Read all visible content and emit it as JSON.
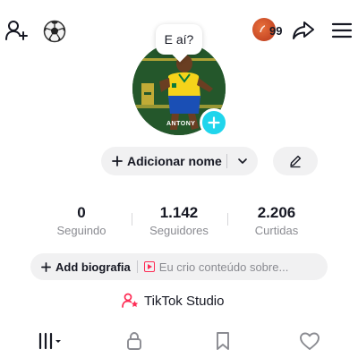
{
  "header": {
    "avatar_bubble": "E aí?",
    "inbox_count": "99"
  },
  "profile": {
    "avatar_caption": "ANTONY",
    "name_button": "Adicionar nome"
  },
  "stats": [
    {
      "value": "0",
      "label": "Seguindo"
    },
    {
      "value": "1.142",
      "label": "Seguidores"
    },
    {
      "value": "2.206",
      "label": "Curtidas"
    }
  ],
  "bio": {
    "add_label": "Add biografia",
    "hint": "Eu crio conteúdo sobre..."
  },
  "studio": {
    "label": "TikTok Studio"
  },
  "tabs": [
    {
      "icon": "grid-icon"
    },
    {
      "icon": "lock-icon"
    },
    {
      "icon": "bookmark-icon"
    },
    {
      "icon": "heart-icon"
    }
  ],
  "colors": {
    "accent_cyan": "#20d5ec",
    "accent_red": "#fe2c55",
    "text_primary": "#161823",
    "text_secondary": "#8a8b91",
    "pill_bg": "#f1f1f2"
  }
}
